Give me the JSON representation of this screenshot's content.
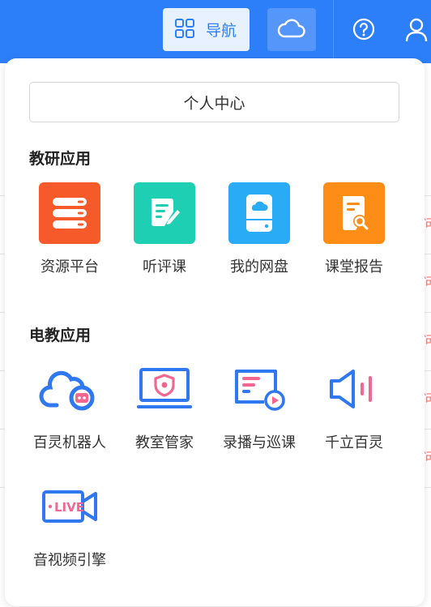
{
  "topbar": {
    "nav_label": "导航",
    "colors": {
      "bar": "#2d7ff9",
      "accent": "#2d7ff9"
    }
  },
  "panel": {
    "personal_center": "个人中心",
    "sections": [
      {
        "title": "教研应用",
        "apps": [
          {
            "label": "资源平台",
            "icon": "server-stack-icon",
            "color": "#f65a2b"
          },
          {
            "label": "听评课",
            "icon": "document-edit-icon",
            "color": "#1fcfb4"
          },
          {
            "label": "我的网盘",
            "icon": "cloud-drive-icon",
            "color": "#2aabf6"
          },
          {
            "label": "课堂报告",
            "icon": "report-search-icon",
            "color": "#fd8d17"
          }
        ]
      },
      {
        "title": "电教应用",
        "apps": [
          {
            "label": "百灵机器人",
            "icon": "cloud-robot-icon"
          },
          {
            "label": "教室管家",
            "icon": "monitor-shield-icon"
          },
          {
            "label": "录播与巡课",
            "icon": "screen-play-icon"
          },
          {
            "label": "千立百灵",
            "icon": "speaker-icon"
          },
          {
            "label": "音视频引擎",
            "icon": "live-camera-icon"
          }
        ]
      }
    ]
  },
  "background": {
    "row_mark": "问"
  }
}
